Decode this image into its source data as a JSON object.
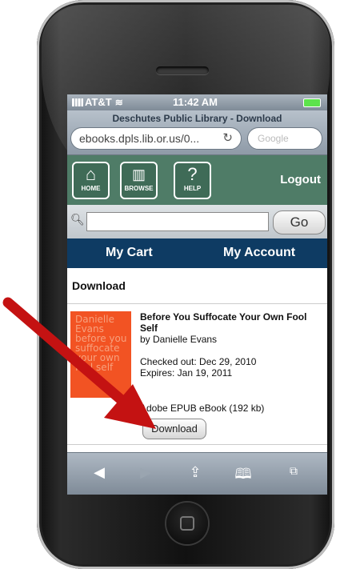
{
  "status": {
    "carrier": "AT&T",
    "time": "11:42 AM"
  },
  "browser": {
    "page_title": "Deschutes Public Library - Download",
    "url": "ebooks.dpls.lib.or.us/0...",
    "search_placeholder": "Google"
  },
  "nav": {
    "buttons": [
      {
        "label": "HOME",
        "icon": "home-icon",
        "glyph": "⌂"
      },
      {
        "label": "BROWSE",
        "icon": "book-icon",
        "glyph": "📖"
      },
      {
        "label": "HELP",
        "icon": "help-icon",
        "glyph": "?"
      }
    ],
    "logout": "Logout"
  },
  "search": {
    "value": "",
    "go_label": "Go"
  },
  "tabs": {
    "cart": "My Cart",
    "account": "My Account"
  },
  "content": {
    "heading": "Download",
    "item": {
      "title": "Before You Suffocate Your Own Fool Self",
      "author": "by Danielle Evans",
      "checked_out": "Checked out: Dec 29, 2010",
      "expires": "Expires: Jan 19, 2011",
      "format": "Adobe EPUB eBook (192 kb)",
      "download_label": "Download",
      "cover_text": "Danielle Evans before you suffocate your own fool self"
    }
  },
  "colors": {
    "nav_green": "#4f7c67",
    "cart_blue": "#0e3b63",
    "cover_orange": "#f25323",
    "arrow_red": "#c41212"
  }
}
